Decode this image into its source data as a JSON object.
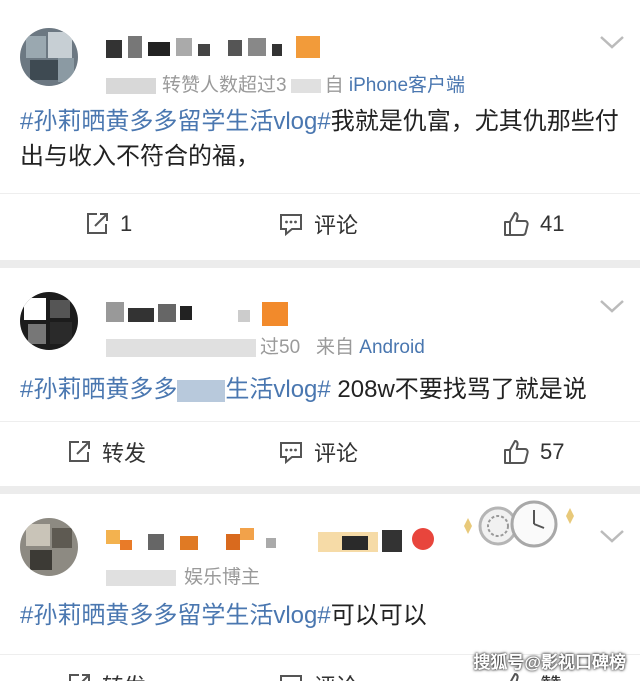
{
  "posts": [
    {
      "meta_prefix": "转赞人数超过3",
      "meta_source": "iPhone客户端",
      "meta_from": "自",
      "hashtag": "#孙莉晒黄多多留学生活vlog#",
      "text": "我就是仇富，尤其仇那些付出与收入不符合的福，",
      "repost_label": "1",
      "comment_label": "评论",
      "like_count": "41"
    },
    {
      "meta_prefix": "过50",
      "meta_from": "来自",
      "meta_source": "Android",
      "hashtag_start": "#孙莉晒黄多多",
      "hashtag_end": "生活vlog#",
      "text": " 208w不要找骂了就是说",
      "repost_label": "转发",
      "comment_label": "评论",
      "like_count": "57"
    },
    {
      "meta_prefix": "娱乐博主",
      "hashtag": "#孙莉晒黄多多留学生活vlog#",
      "text": "可以可以",
      "repost_label": "转发",
      "comment_label": "评论",
      "like_label": "赞"
    }
  ],
  "icons": [
    "share-icon",
    "comment-icon",
    "like-icon",
    "chevron-down-icon"
  ],
  "colors": {
    "link": "#4a77b0",
    "meta": "#9a9a9a",
    "separator": "#ececec"
  },
  "watermark": "搜狐号@影视口碑榜"
}
